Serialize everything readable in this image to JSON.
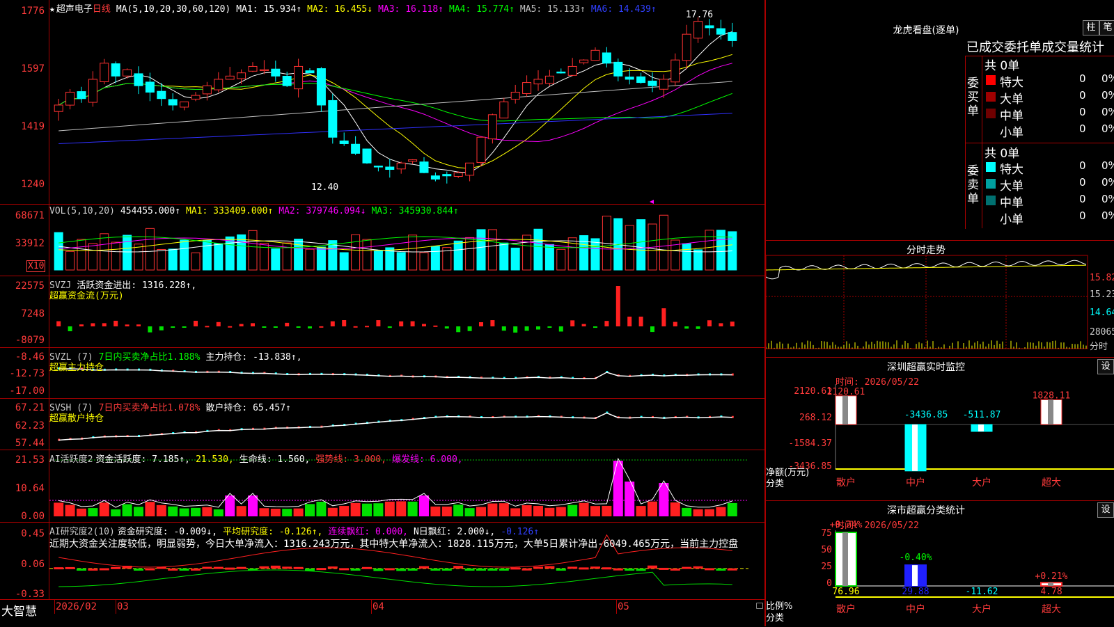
{
  "main": {
    "title_star": "★",
    "stock_name": "超声电子",
    "period": "日线",
    "ma_params": "MA(5,10,20,30,60,120)",
    "ma": [
      {
        "label": "MA1: 15.934↑",
        "color": "#ffffff"
      },
      {
        "label": "MA2: 16.455↓",
        "color": "#ffff00"
      },
      {
        "label": "MA3: 16.118↑",
        "color": "#ff00ff"
      },
      {
        "label": "MA4: 15.774↑",
        "color": "#00ff00"
      },
      {
        "label": "MA5: 15.133↑",
        "color": "#c0c0c0"
      },
      {
        "label": "MA6: 14.439↑",
        "color": "#3030ff"
      }
    ],
    "yticks": [
      "1776",
      "1597",
      "1419",
      "1240"
    ],
    "high_label": "17.76",
    "low_label": "12.40"
  },
  "vol": {
    "title": "VOL(5,10,20)",
    "value": "454455.000↑",
    "ma1": "MA1: 333409.000↑",
    "ma2": "MA2: 379746.094↓",
    "ma3": "MA3: 345930.844↑",
    "yticks": [
      "68671",
      "33912"
    ],
    "unit": "X10"
  },
  "svzj": {
    "title": "SVZJ",
    "line": "活跃资金进出: 1316.228↑,",
    "sub": "超赢资金流(万元)",
    "yticks": [
      "22575",
      "7248",
      "-8079"
    ]
  },
  "svzl": {
    "title": "SVZL (7)",
    "ratio": "7日内买卖净占比1.188%",
    "line": "主力持仓: -13.838↑,",
    "sub": "超赢主力持仓",
    "yticks": [
      "-8.46",
      "-12.73",
      "-17.00"
    ]
  },
  "svsh": {
    "title": "SVSH (7)",
    "ratio": "7日内买卖净占比1.078%",
    "line": "散户持仓: 65.457↑",
    "sub": "超赢散户持仓",
    "yticks": [
      "67.21",
      "62.23",
      "57.44"
    ]
  },
  "ai1": {
    "title": "AI活跃度2",
    "a": "资金活跃度: 7.185↑,",
    "b": "21.530,",
    "c": "生命线: 1.560,",
    "d": "强势线: 3.000,",
    "e": "爆发线: 6.000,",
    "yticks": [
      "21.53",
      "10.64",
      "0.00"
    ]
  },
  "ai2": {
    "title": "AI研究度2(10)",
    "a": "资金研究度: -0.009↓,",
    "b": "平均研究度: -0.126↑,",
    "c": "连续飘红: 0.000,",
    "d": "N日飘红: 2.000↓,",
    "e": "-0.126↑",
    "comment": "近期大资金关注度较低，明显弱势，今日大单净流入：1316.243万元，其中特大单净流入：1828.115万元，大单5日累计净出-6049.465万元，当前主力控盘",
    "yticks": [
      "0.45",
      "0.06",
      "-0.33"
    ]
  },
  "xaxis": {
    "brand": "大智慧",
    "labels": [
      "2026/02",
      "03",
      "04",
      "05"
    ]
  },
  "lhkp": {
    "title": "龙虎看盘(逐单)",
    "btn1": "柱",
    "btn2": "笔",
    "tabs": [
      "已成交",
      "委托单",
      "成交量统计"
    ],
    "buy_label": "委买单",
    "sell_label": "委卖单",
    "buy_total": "共 0单",
    "sell_total": "共 0单",
    "buy_rows": [
      {
        "name": "特大",
        "count": "0",
        "pct": "0%",
        "color": "#ff0000"
      },
      {
        "name": "大单",
        "count": "0",
        "pct": "0%",
        "color": "#a00000"
      },
      {
        "name": "中单",
        "count": "0",
        "pct": "0%",
        "color": "#700000"
      },
      {
        "name": "小单",
        "count": "0",
        "pct": "0%",
        "color": "#000000"
      }
    ],
    "sell_rows": [
      {
        "name": "特大",
        "count": "0",
        "pct": "0%",
        "color": "#00ffff"
      },
      {
        "name": "大单",
        "count": "0",
        "pct": "0%",
        "color": "#00a0a0"
      },
      {
        "name": "中单",
        "count": "0",
        "pct": "0%",
        "color": "#007070"
      },
      {
        "name": "小单",
        "count": "0",
        "pct": "0%",
        "color": "#000000"
      }
    ]
  },
  "fenshi": {
    "title": "分时走势",
    "yticks": [
      "15.82",
      "15.23",
      "14.64",
      "28065"
    ],
    "unit": "分时"
  },
  "monitor": {
    "title": "深圳超赢实时监控",
    "btn": "设",
    "time": "时间: 2026/05/22",
    "yticks": [
      "2120.61",
      "268.12",
      "-1584.37",
      "-3436.85"
    ],
    "ylabel": "净额(万元)",
    "xlabel": "分类",
    "cats": [
      "散户",
      "中户",
      "大户",
      "超大"
    ],
    "bar_labels": [
      "2120.61",
      "-3436.85",
      "-511.87",
      "1828.11"
    ]
  },
  "classify": {
    "title": "深市超赢分类统计",
    "btn": "设",
    "time": "时间: 2026/05/22",
    "yticks": [
      "75",
      "50",
      "25",
      "0"
    ],
    "ylabel": "比例%",
    "xlabel": "分类",
    "cats": [
      "散户",
      "中户",
      "大户",
      "超大"
    ],
    "top_labels": [
      "+0.24%",
      "-0.40%",
      "",
      "+0.21%"
    ],
    "bottom_labels": [
      "76.96",
      "29.88",
      "-11.62",
      "4.78"
    ]
  }
}
